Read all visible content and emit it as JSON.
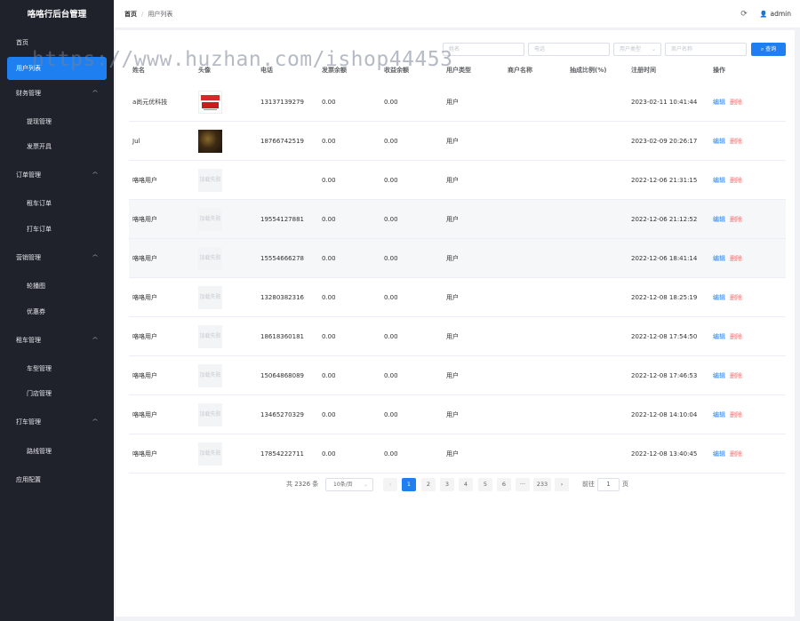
{
  "app": {
    "title": "咯咯行后台管理"
  },
  "sidebar": {
    "items": [
      {
        "label": "首页"
      },
      {
        "label": "用户列表"
      },
      {
        "label": "财务管理"
      },
      {
        "label": "提现管理"
      },
      {
        "label": "发票开具"
      },
      {
        "label": "订单管理"
      },
      {
        "label": "租车订单"
      },
      {
        "label": "打车订单"
      },
      {
        "label": "营销管理"
      },
      {
        "label": "轮播图"
      },
      {
        "label": "优惠券"
      },
      {
        "label": "租车管理"
      },
      {
        "label": "车型管理"
      },
      {
        "label": "门店管理"
      },
      {
        "label": "打车管理"
      },
      {
        "label": "路线管理"
      },
      {
        "label": "应用配置"
      }
    ]
  },
  "header": {
    "breadcrumb": [
      "首页",
      "用户列表"
    ],
    "separator": "/",
    "user": "admin"
  },
  "filters": {
    "name_placeholder": "姓名",
    "phone_placeholder": "电话",
    "type_placeholder": "用户类型",
    "merchant_placeholder": "商户名称",
    "query_label": "查询"
  },
  "table": {
    "columns": [
      "姓名",
      "头像",
      "电话",
      "发票余额",
      "收益余额",
      "用户类型",
      "商户名称",
      "抽成比例(%)",
      "注册时间",
      "操作"
    ],
    "avatar_fail_text": "加载失败",
    "edit_label": "编辑",
    "delete_label": "删除",
    "rows": [
      {
        "name": "a尚元优科技",
        "phone": "13137139279",
        "invoice": "0.00",
        "income": "0.00",
        "type": "用户",
        "merchant": "",
        "ratio": "",
        "time": "2023-02-11 10:41:44"
      },
      {
        "name": "Jul",
        "phone": "18766742519",
        "invoice": "0.00",
        "income": "0.00",
        "type": "用户",
        "merchant": "",
        "ratio": "",
        "time": "2023-02-09 20:26:17"
      },
      {
        "name": "咯咯用户",
        "phone": "",
        "invoice": "0.00",
        "income": "0.00",
        "type": "用户",
        "merchant": "",
        "ratio": "",
        "time": "2022-12-06 21:31:15"
      },
      {
        "name": "咯咯用户",
        "phone": "19554127881",
        "invoice": "0.00",
        "income": "0.00",
        "type": "用户",
        "merchant": "",
        "ratio": "",
        "time": "2022-12-06 21:12:52"
      },
      {
        "name": "咯咯用户",
        "phone": "15554666278",
        "invoice": "0.00",
        "income": "0.00",
        "type": "用户",
        "merchant": "",
        "ratio": "",
        "time": "2022-12-06 18:41:14"
      },
      {
        "name": "咯咯用户",
        "phone": "13280382316",
        "invoice": "0.00",
        "income": "0.00",
        "type": "用户",
        "merchant": "",
        "ratio": "",
        "time": "2022-12-08 18:25:19"
      },
      {
        "name": "咯咯用户",
        "phone": "18618360181",
        "invoice": "0.00",
        "income": "0.00",
        "type": "用户",
        "merchant": "",
        "ratio": "",
        "time": "2022-12-08 17:54:50"
      },
      {
        "name": "咯咯用户",
        "phone": "15064868089",
        "invoice": "0.00",
        "income": "0.00",
        "type": "用户",
        "merchant": "",
        "ratio": "",
        "time": "2022-12-08 17:46:53"
      },
      {
        "name": "咯咯用户",
        "phone": "13465270329",
        "invoice": "0.00",
        "income": "0.00",
        "type": "用户",
        "merchant": "",
        "ratio": "",
        "time": "2022-12-08 14:10:04"
      },
      {
        "name": "咯咯用户",
        "phone": "17854222711",
        "invoice": "0.00",
        "income": "0.00",
        "type": "用户",
        "merchant": "",
        "ratio": "",
        "time": "2022-12-08 13:40:45"
      }
    ]
  },
  "pagination": {
    "total": "共 2326 条",
    "page_size": "10条/页",
    "pages": [
      "1",
      "2",
      "3",
      "4",
      "5",
      "6",
      "···",
      "233"
    ],
    "current": "1",
    "goto_label": "前往",
    "goto_value": "1",
    "unit": "页"
  },
  "watermark": "https://www.huzhan.com/ishop44453",
  "colors": {
    "primary": "#1e7ff0",
    "danger": "#f56c6c",
    "sidebar": "#1f222b"
  }
}
